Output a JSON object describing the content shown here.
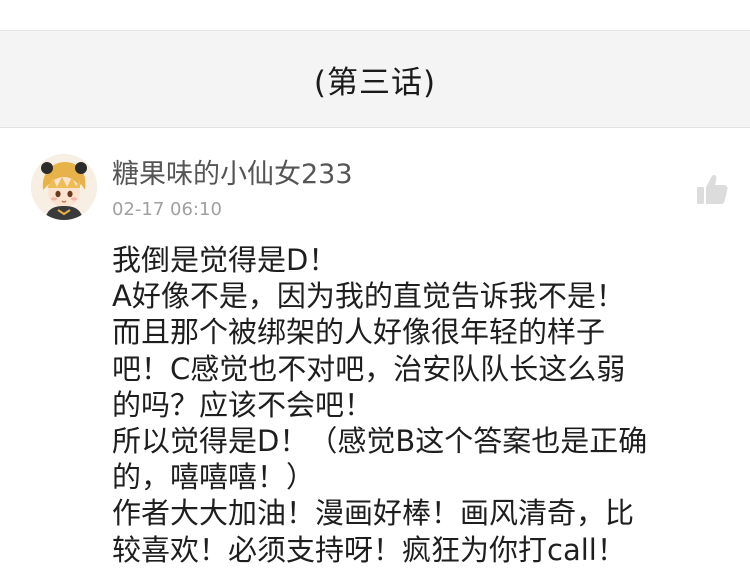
{
  "header": {
    "chapter_title": "(第三话)"
  },
  "comment": {
    "username": "糖果味的小仙女233",
    "timestamp": "02-17 06:10",
    "body_lines": [
      "我倒是觉得是D！",
      "A好像不是，因为我的直觉告诉我不是！",
      "而且那个被绑架的人好像很年轻的样子",
      "吧！C感觉也不对吧，治安队队长这么弱",
      "的吗？应该不会吧！",
      "所以觉得是D！（感觉B这个答案也是正确",
      "的，嘻嘻嘻！）",
      "作者大大加油！漫画好棒！画风清奇，比",
      "较喜欢！必须支持呀！疯狂为你打call！"
    ],
    "like_icon": "thumbs-up-icon",
    "avatar_icon": "anime-avatar-icon"
  },
  "colors": {
    "page_background": "#f2f2f2",
    "card_background": "#ffffff",
    "username": "#555555",
    "timestamp": "#a0a0a0",
    "like_icon": "#dcdcdc"
  }
}
